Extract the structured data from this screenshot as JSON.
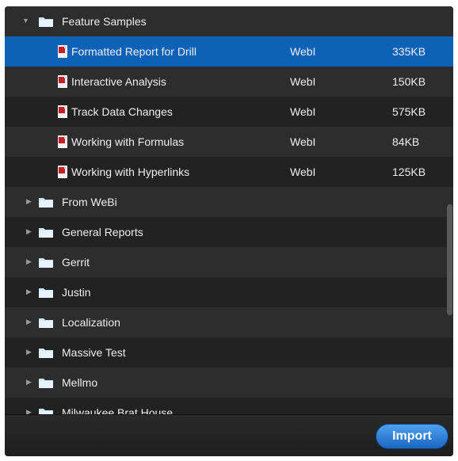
{
  "open_folder": {
    "label": "Feature Samples",
    "icon": "folder-icon"
  },
  "documents": [
    {
      "name": "Formatted Report for Drill",
      "type": "WebI",
      "size": "335KB",
      "selected": true
    },
    {
      "name": "Interactive Analysis",
      "type": "WebI",
      "size": "150KB"
    },
    {
      "name": "Track Data Changes",
      "type": "WebI",
      "size": "575KB"
    },
    {
      "name": "Working with Formulas",
      "type": "WebI",
      "size": "84KB"
    },
    {
      "name": "Working with Hyperlinks",
      "type": "WebI",
      "size": "125KB"
    }
  ],
  "folders": [
    {
      "label": "From WeBi"
    },
    {
      "label": "General Reports"
    },
    {
      "label": "Gerrit"
    },
    {
      "label": "Justin"
    },
    {
      "label": "Localization"
    },
    {
      "label": "Massive Test"
    },
    {
      "label": "Mellmo"
    },
    {
      "label": "Milwaukee Brat House"
    }
  ],
  "footer": {
    "import_label": "Import"
  },
  "colors": {
    "selection": "#0d62b7",
    "panel_bg": "#262626",
    "button_blue": "#1a67c2"
  }
}
